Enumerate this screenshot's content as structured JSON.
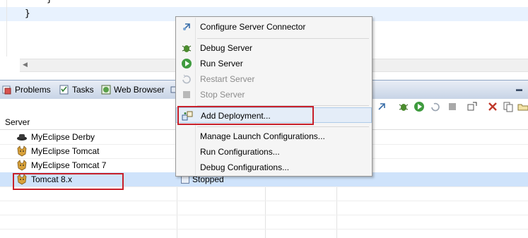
{
  "editor": {
    "lines": [
      "}",
      "}"
    ]
  },
  "views": {
    "tabs": [
      {
        "label": "Problems",
        "icon": "problems-icon"
      },
      {
        "label": "Tasks",
        "icon": "tasks-icon"
      },
      {
        "label": "Web Browser",
        "icon": "web-browser-icon"
      }
    ]
  },
  "servers": {
    "column_header": "Server",
    "rows": [
      {
        "name": "MyEclipse Derby",
        "icon": "derby-icon",
        "status": ""
      },
      {
        "name": "MyEclipse Tomcat",
        "icon": "tomcat-icon",
        "status": ""
      },
      {
        "name": "MyEclipse Tomcat 7",
        "icon": "tomcat-icon",
        "status": ""
      },
      {
        "name": "Tomcat  8.x",
        "icon": "tomcat-icon",
        "status": "Stopped",
        "selected": true
      }
    ]
  },
  "menu": {
    "items": [
      {
        "label": "Configure Server Connector",
        "icon": "server-connector-icon",
        "enabled": true
      },
      {
        "label": "Debug Server",
        "icon": "bug-icon",
        "enabled": true
      },
      {
        "label": "Run Server",
        "icon": "run-icon",
        "enabled": true
      },
      {
        "label": "Restart Server",
        "icon": "restart-icon",
        "enabled": false
      },
      {
        "label": "Stop Server",
        "icon": "stop-icon",
        "enabled": false
      },
      {
        "label": "Add Deployment...",
        "icon": "add-deployment-icon",
        "enabled": true,
        "highlighted": true
      },
      {
        "label": "Manage Launch Configurations...",
        "icon": "",
        "enabled": true
      },
      {
        "label": "Run Configurations...",
        "icon": "",
        "enabled": true
      },
      {
        "label": "Debug Configurations...",
        "icon": "",
        "enabled": true
      }
    ]
  },
  "colors": {
    "highlight_box": "#c8202a",
    "selection": "#cfe3fb",
    "tabbar": "#c7d4e6"
  }
}
